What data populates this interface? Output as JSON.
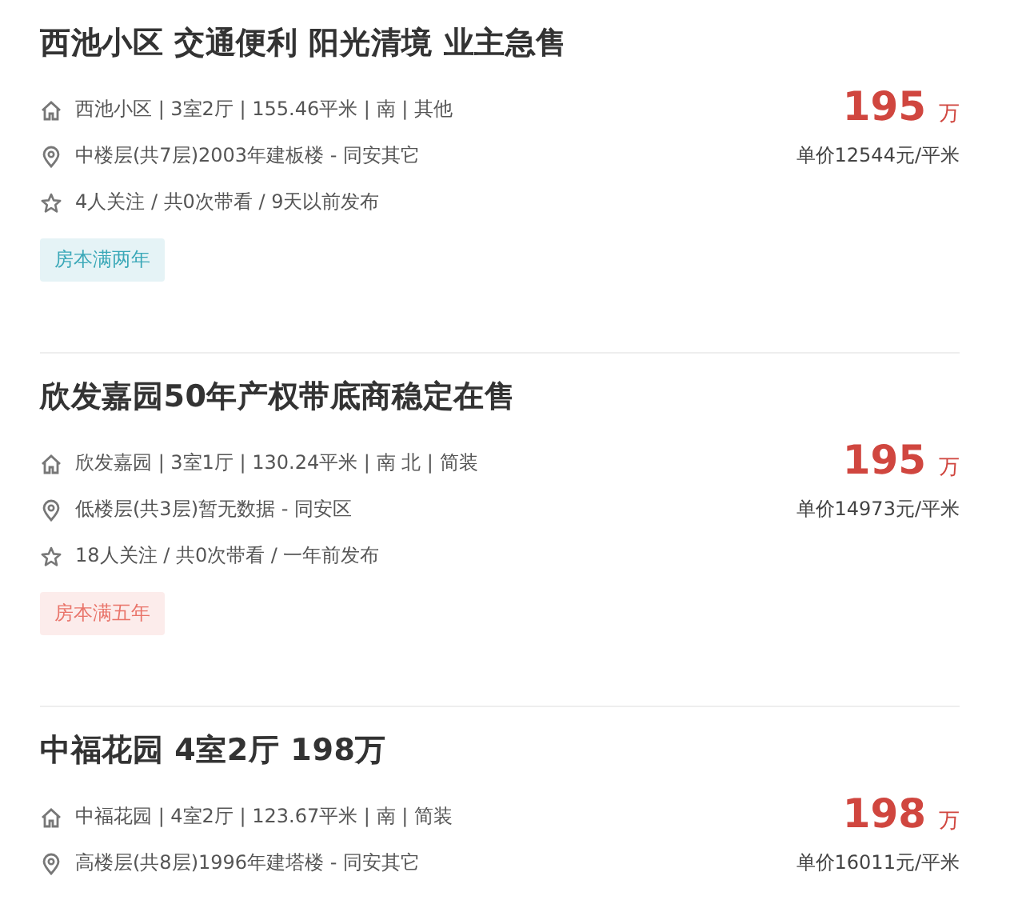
{
  "listings": [
    {
      "title": "西池小区 交通便利 阳光清境 业主急售",
      "info": "西池小区 | 3室2厅 | 155.46平米 | 南 | 其他",
      "position": "中楼层(共7层)2003年建板楼 - 同安其它",
      "follow": "4人关注 / 共0次带看 / 9天以前发布",
      "tag": {
        "label": "房本满两年",
        "color": "#3aa8b8"
      },
      "price": "195",
      "price_unit": "万",
      "unit_price": "单价12544元/平米"
    },
    {
      "title": "欣发嘉园50年产权带底商稳定在售",
      "info": "欣发嘉园 | 3室1厅 | 130.24平米 | 南 北 | 简装",
      "position": "低楼层(共3层)暂无数据 - 同安区",
      "follow": "18人关注 / 共0次带看 / 一年前发布",
      "tag": {
        "label": "房本满五年",
        "color": "#e9746a"
      },
      "price": "195",
      "price_unit": "万",
      "unit_price": "单价14973元/平米"
    },
    {
      "title": "中福花园 4室2厅 198万",
      "info": "中福花园 | 4室2厅 | 123.67平米 | 南 | 简装",
      "position": "高楼层(共8层)1996年建塔楼 - 同安其它",
      "price": "198",
      "price_unit": "万",
      "unit_price": "单价16011元/平米"
    }
  ]
}
